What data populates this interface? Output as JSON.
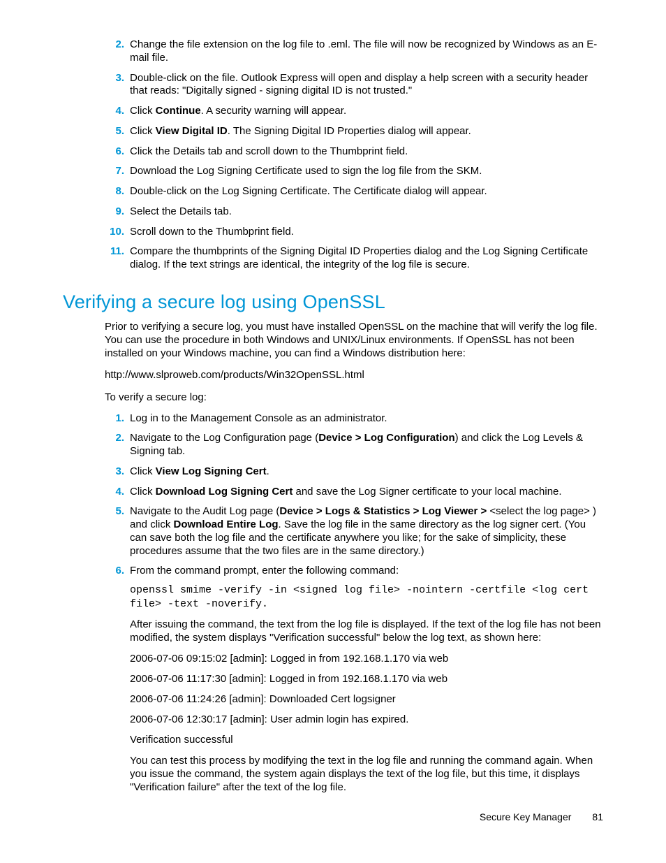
{
  "listA": {
    "n2": "2.",
    "i2": "Change the file extension on the log file to .eml.  The file will now be recognized by Windows as an E-mail file.",
    "n3": "3.",
    "i3": "Double-click on the file.  Outlook Express will open and display a help screen with a security header that reads:  \"Digitally signed - signing digital ID is not trusted.\"",
    "n4": "4.",
    "i4a": "Click ",
    "i4b": "Continue",
    "i4c": ".  A security warning will appear.",
    "n5": "5.",
    "i5a": "Click ",
    "i5b": "View Digital ID",
    "i5c": ". The Signing Digital ID Properties dialog will appear.",
    "n6": "6.",
    "i6": "Click the Details tab and scroll down to the Thumbprint field.",
    "n7": "7.",
    "i7": "Download the Log Signing Certificate used to sign the log file from the SKM.",
    "n8": "8.",
    "i8": "Double-click on the Log Signing Certificate.  The Certificate dialog will appear.",
    "n9": "9.",
    "i9": "Select the Details tab.",
    "n10": "10.",
    "i10": "Scroll down to the Thumbprint field.",
    "n11": "11.",
    "i11": "Compare the thumbprints of the Signing Digital ID Properties dialog and the Log Signing Certificate dialog. If the text strings are identical, the integrity of the log file is secure."
  },
  "heading": "Verifying a secure log using OpenSSL",
  "intro": "Prior to verifying a secure log, you must have installed OpenSSL on the machine that will verify the log file.  You can use the procedure in both Windows and UNIX/Linux environments.  If OpenSSL has not been installed on your Windows machine, you can find a Windows distribution here:",
  "url": "http://www.slproweb.com/products/Win32OpenSSL.html",
  "toverify": "To verify a secure log:",
  "listB": {
    "n1": "1.",
    "i1": "Log in to the Management Console as an administrator.",
    "n2": "2.",
    "i2a": "Navigate to the Log Configuration page (",
    "i2b": "Device > Log Configuration",
    "i2c": ") and click the Log Levels & Signing tab.",
    "n3": "3.",
    "i3a": "Click ",
    "i3b": "View Log Signing Cert",
    "i3c": ".",
    "n4": "4.",
    "i4a": "Click ",
    "i4b": "Download Log Signing Cert",
    "i4c": " and save the Log Signer certificate to your local machine.",
    "n5": "5.",
    "i5a": "Navigate to the Audit Log page (",
    "i5b": "Device > Logs & Statistics > Log Viewer > ",
    "i5c": "<select the log page> ) and click ",
    "i5d": "Download Entire Log",
    "i5e": ". Save the log file in the same directory as the log signer cert. (You can save both the log file and the certificate anywhere you like; for the sake of simplicity, these procedures assume that the two files are in the same directory.)",
    "n6": "6.",
    "i6": "From the command prompt, enter the following command:",
    "cmd": "openssl smime -verify -in <signed log file> -nointern -certfile <log cert file> -text -noverify.",
    "after_cmd": "After issuing the command, the text from the log file is displayed.  If the text of the log file has not been modified, the system displays \"Verification successful\" below the log text, as shown here:",
    "log1": "2006-07-06 09:15:02 [admin]:  Logged in from 192.168.1.170 via web",
    "log2": "2006-07-06 11:17:30 [admin]:  Logged in from 192.168.1.170 via web",
    "log3": "2006-07-06 11:24:26 [admin]:  Downloaded Cert logsigner",
    "log4": "2006-07-06 12:30:17 [admin]:  User admin login has expired.",
    "log5": "Verification successful",
    "closing": "You can test this process by modifying the text in the log file and running the command again.  When you issue the command, the system again displays the text of the log file, but this time, it displays \"Verification failure\" after the text of the log file."
  },
  "footer_label": "Secure Key Manager",
  "footer_page": "81"
}
